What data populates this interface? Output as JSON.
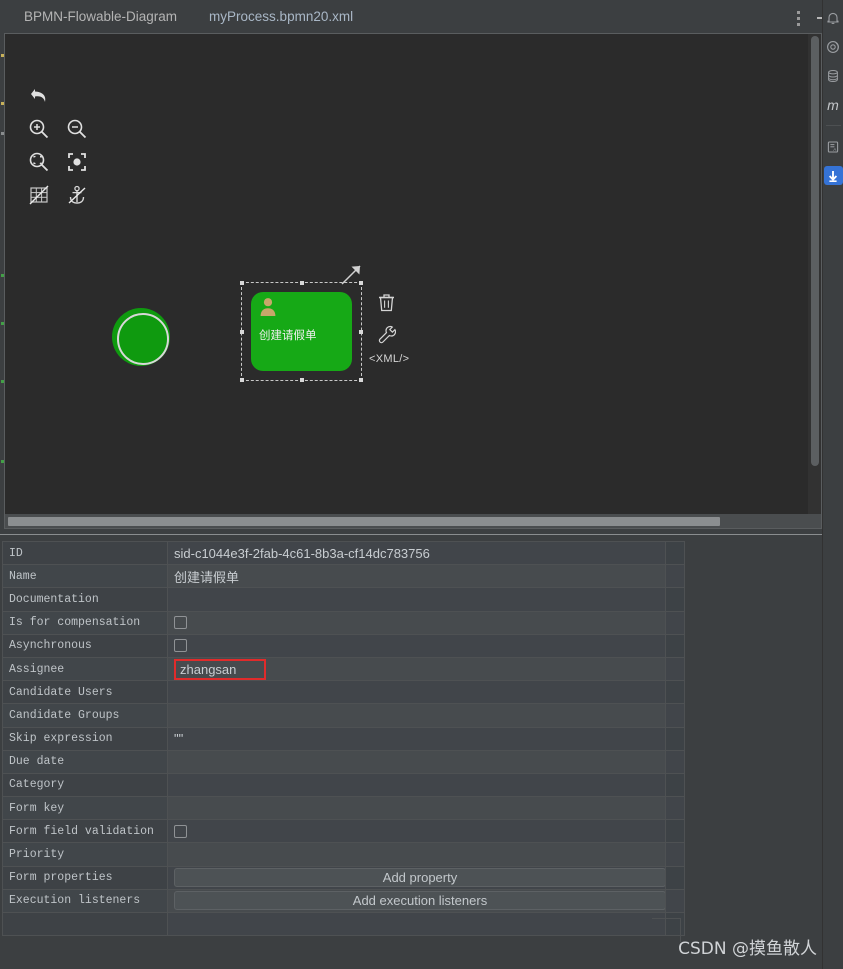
{
  "window": {
    "tabs": [
      {
        "label": "BPMN-Flowable-Diagram",
        "active": false
      },
      {
        "label": "myProcess.bpmn20.xml",
        "active": true
      }
    ],
    "kebab_menu": "more-options",
    "minimize": "minimize"
  },
  "colors": {
    "accent_tab": "#4d88c4",
    "node_green": "#16a916",
    "start_green": "#0f9a0f",
    "highlight_red": "#e02b2b",
    "selected_tool": "#3573d6",
    "canvas_bg": "#2b2b2b",
    "panel_bg": "#3c3f41",
    "user_icon_tan": "#c8a76a"
  },
  "diagram_toolbar": [
    {
      "icon": "undo-icon",
      "label": "Undo"
    },
    {
      "icon": "zoom-in-icon",
      "label": "Zoom In"
    },
    {
      "icon": "zoom-out-icon",
      "label": "Zoom Out"
    },
    {
      "icon": "zoom-fit-icon",
      "label": "Zoom To Fit"
    },
    {
      "icon": "zoom-actual-icon",
      "label": "Zoom To Actual Size"
    },
    {
      "icon": "grid-toggle-icon",
      "label": "Toggle Grid"
    },
    {
      "icon": "anchor-toggle-icon",
      "label": "Toggle Snap To Grid"
    }
  ],
  "canvas": {
    "start_event": {
      "name": "start-event-node",
      "shape": "circle"
    },
    "task": {
      "name": "user-task-node",
      "label": "创建请假单",
      "type": "userTask",
      "selected": true
    },
    "context_actions": [
      {
        "icon": "connection-arrow-icon",
        "label": "Create connection"
      },
      {
        "icon": "trash-icon",
        "label": "Delete"
      },
      {
        "icon": "wrench-icon",
        "label": "Morph / Configure"
      },
      {
        "icon": "xml-icon",
        "label": "<XML/>"
      }
    ],
    "scrollbars": {
      "horizontal": "h-scrollbar",
      "vertical": "v-scrollbar"
    }
  },
  "right_sidebar": [
    {
      "icon": "notifications-bell-icon",
      "label": "Notifications",
      "selected": false
    },
    {
      "icon": "at-circle-icon",
      "label": "Profiler",
      "selected": false
    },
    {
      "icon": "database-icon",
      "label": "Database",
      "selected": false
    },
    {
      "icon": "maven-icon",
      "label": "Maven",
      "selected": false
    },
    {
      "icon": "document-icon",
      "label": "Documentation",
      "selected": false
    },
    {
      "icon": "download-icon",
      "label": "Gradle / Load",
      "selected": true
    }
  ],
  "properties": {
    "rows": [
      {
        "key": "ID",
        "kind": "text",
        "value": "sid-c1044e3f-2fab-4c61-8b3a-cf14dc783756"
      },
      {
        "key": "Name",
        "kind": "cjk",
        "value": "创建请假单"
      },
      {
        "key": "Documentation",
        "kind": "text",
        "value": ""
      },
      {
        "key": "Is for compensation",
        "kind": "checkbox",
        "value": "",
        "checked": false
      },
      {
        "key": "Asynchronous",
        "kind": "checkbox",
        "value": "",
        "checked": false
      },
      {
        "key": "Assignee",
        "kind": "highlight",
        "value": "zhangsan"
      },
      {
        "key": "Candidate Users",
        "kind": "text",
        "value": ""
      },
      {
        "key": "Candidate Groups",
        "kind": "text",
        "value": ""
      },
      {
        "key": "Skip expression",
        "kind": "text",
        "value": "\"\""
      },
      {
        "key": "Due date",
        "kind": "text",
        "value": ""
      },
      {
        "key": "Category",
        "kind": "text",
        "value": ""
      },
      {
        "key": "Form key",
        "kind": "text",
        "value": ""
      },
      {
        "key": "Form field validation",
        "kind": "checkbox",
        "value": "",
        "checked": false
      },
      {
        "key": "Priority",
        "kind": "text",
        "value": ""
      },
      {
        "key": "Form properties",
        "kind": "button",
        "value": "Add property"
      },
      {
        "key": "Execution listeners",
        "kind": "button",
        "value": "Add execution listeners"
      },
      {
        "key": "",
        "kind": "text",
        "value": ""
      }
    ]
  },
  "watermark": {
    "text": "CSDN @摸鱼散人"
  }
}
